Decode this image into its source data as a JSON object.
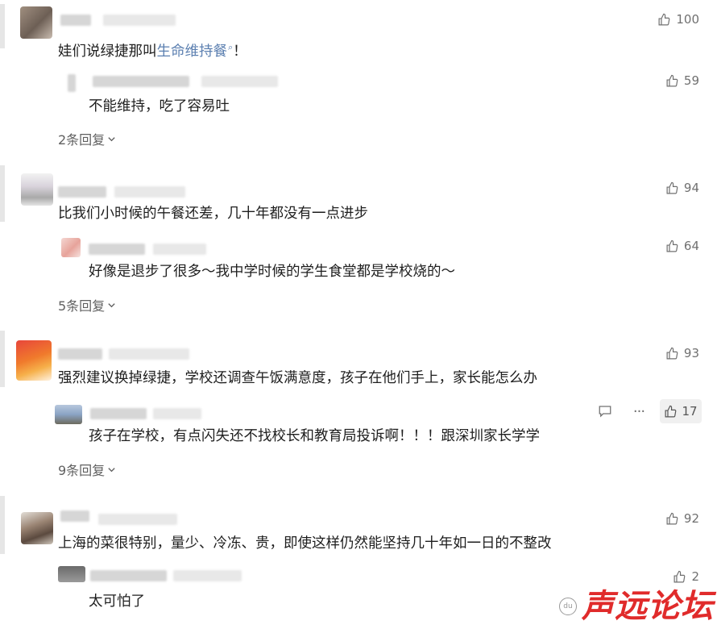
{
  "colors": {
    "link": "#5b7fb0",
    "text": "#1e1e1e",
    "meta": "#707070",
    "watermark": "#e02b2b"
  },
  "comments": [
    {
      "text_prefix": "娃们说绿捷那叫",
      "link": "生命维持餐",
      "text_suffix": "！",
      "likes": "100",
      "reply": {
        "text": "不能维持，吃了容易吐",
        "likes": "59"
      },
      "more_replies": "2条回复"
    },
    {
      "text": "比我们小时候的午餐还差，几十年都没有一点进步",
      "likes": "94",
      "reply": {
        "text": "好像是退步了很多～我中学时候的学生食堂都是学校烧的～",
        "likes": "64"
      },
      "more_replies": "5条回复"
    },
    {
      "text": "强烈建议换掉绿捷，学校还调查午饭满意度，孩子在他们手上，家长能怎么办",
      "likes": "93",
      "reply": {
        "text": "孩子在学校，有点闪失还不找校长和教育局投诉啊！！！跟深圳家长学学",
        "likes": "17"
      },
      "more_replies": "9条回复"
    },
    {
      "text": "上海的菜很特别，量少、冷冻、贵，即使这样仍然能坚持几十年如一日的不整改",
      "likes": "92",
      "reply": {
        "text": "太可怕了",
        "likes": "2"
      }
    }
  ],
  "watermark": {
    "text": "声远论坛",
    "logo": "du"
  }
}
